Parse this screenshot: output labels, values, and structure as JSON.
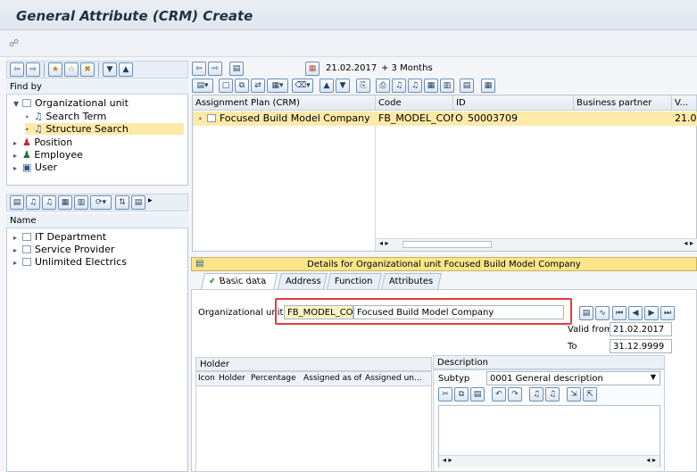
{
  "window": {
    "title": "General Attribute (CRM) Create"
  },
  "left": {
    "find_by_label": "Find by",
    "tree": [
      {
        "label": "Organizational unit"
      },
      {
        "label": "Search Term"
      },
      {
        "label": "Structure Search"
      },
      {
        "label": "Position"
      },
      {
        "label": "Employee"
      },
      {
        "label": "User"
      }
    ],
    "name_header": "Name",
    "names": [
      "IT Department",
      "Service Provider",
      "Unlimited Electrics"
    ]
  },
  "top": {
    "date": "21.02.2017",
    "period": "+ 3 Months"
  },
  "grid": {
    "headers": [
      "Assignment Plan (CRM)",
      "Code",
      "ID",
      "Business partner",
      "V..."
    ],
    "row": {
      "name": "Focused Build Model Company",
      "code": "FB_MODEL_COM",
      "type": "O",
      "id": "50003709",
      "valid": "21.0"
    }
  },
  "details": {
    "bar_text": "Details for Organizational unit Focused Build Model Company",
    "tabs": [
      "Basic data",
      "Address",
      "Function",
      "Attributes"
    ],
    "org_unit_label": "Organizational unit",
    "org_code": "FB_MODEL_COM",
    "org_name": "Focused Build Model Company",
    "valid_from_label": "Valid from",
    "valid_from": "21.02.2017",
    "to_label": "To",
    "to": "31.12.9999",
    "holder_header": "Holder",
    "holder_cols": [
      "Icon",
      "Holder",
      "Percentage",
      "Assigned as of",
      "Assigned un..."
    ],
    "description_header": "Description",
    "subtyp_label": "Subtyp",
    "subtyp_value": "0001 General description"
  }
}
